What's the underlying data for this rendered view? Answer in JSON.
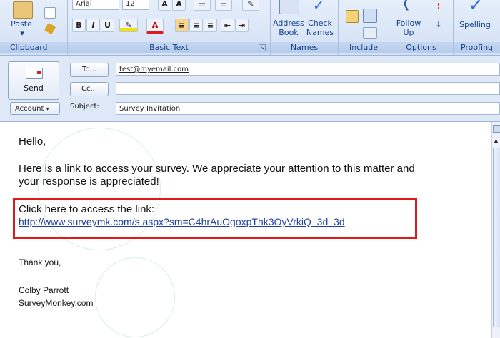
{
  "ribbon": {
    "clipboard": {
      "paste": "Paste",
      "label": "Clipboard"
    },
    "basic_text": {
      "font": "Arial",
      "size": "12",
      "bold": "B",
      "italic": "I",
      "underline": "U",
      "font_color": "A",
      "label": "Basic Text"
    },
    "names": {
      "address_book": "Address\nBook",
      "check_names": "Check\nNames",
      "label": "Names"
    },
    "include": {
      "label": "Include"
    },
    "options": {
      "follow_up": "Follow\nUp",
      "label": "Options"
    },
    "proofing": {
      "spelling": "Spelling",
      "label": "Proofing"
    }
  },
  "compose": {
    "send_label": "Send",
    "to_label": "To...",
    "to_value": "test@myemail.com",
    "cc_label": "Cc...",
    "cc_value": "",
    "account_label": "Account",
    "subject_label": "Subject:",
    "subject_value": "Survey Invitation"
  },
  "message": {
    "greeting": "Hello,",
    "paragraph": "Here is a link to access your survey. We appreciate your attention to this matter and your response is appreciated!",
    "paragraph_line1": "Here is a link to access your survey. We appreciate your attention to this matter and",
    "paragraph_line2": "your response is appreciated!",
    "link_intro": "Click here to access the link:",
    "link_url": "http://www.surveymk.com/s.aspx?sm=C4hrAuOgoxpThk3OyVrkiQ_3d_3d",
    "closing": "Thank you,",
    "signature_name": "Colby Parrott",
    "signature_org": "SurveyMonkey.com"
  },
  "colors": {
    "highlight_box": "#e01a1a",
    "link": "#1f3fa8",
    "ribbon_text": "#15428b"
  }
}
